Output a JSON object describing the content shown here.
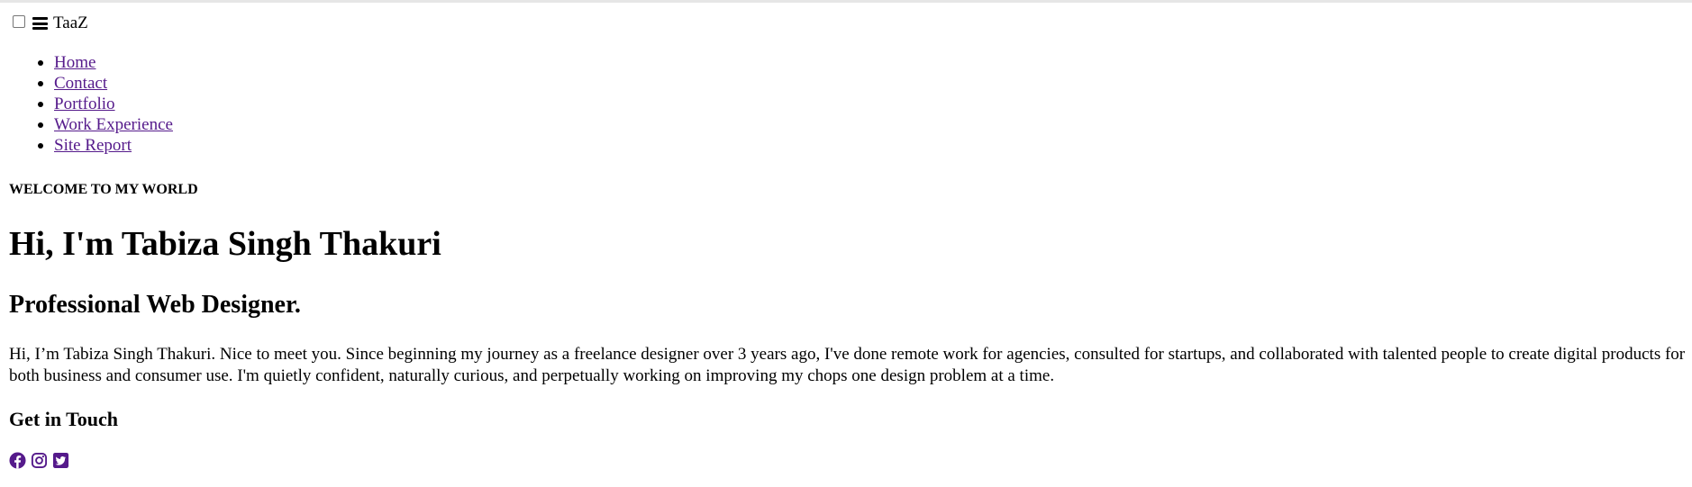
{
  "header": {
    "brand": "TaaZ",
    "menu_icon": "hamburger-icon"
  },
  "nav": {
    "items": [
      {
        "label": "Home"
      },
      {
        "label": "Contact"
      },
      {
        "label": "Portfolio"
      },
      {
        "label": "Work Experience"
      },
      {
        "label": "Site Report"
      }
    ]
  },
  "hero": {
    "eyebrow": "WELCOME TO MY WORLD",
    "title": "Hi, I'm Tabiza Singh Thakuri",
    "subtitle": "Professional Web Designer.",
    "intro": "Hi, I’m Tabiza Singh Thakuri. Nice to meet you. Since beginning my journey as a freelance designer over 3 years ago, I've done remote work for agencies, consulted for startups, and collaborated with talented people to create digital products for both business and consumer use. I'm quietly confident, naturally curious, and perpetually working on improving my chops one design problem at a time."
  },
  "contact": {
    "heading": "Get in Touch",
    "icons": [
      "facebook-icon",
      "instagram-icon",
      "twitter-icon"
    ]
  },
  "colors": {
    "link": "#551a8b",
    "text": "#000000",
    "background": "#ffffff"
  }
}
